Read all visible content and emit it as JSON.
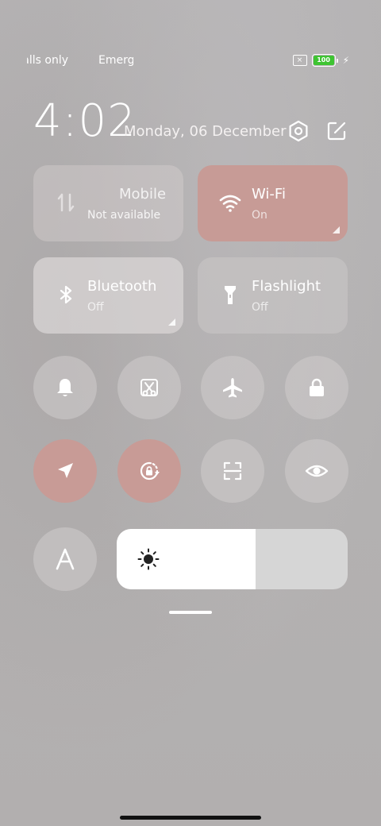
{
  "status_bar": {
    "carrier_left": "Emergency calls only",
    "carrier_right": "Emergency calls",
    "battery_level": "100",
    "colors": {
      "battery": "#3ec432"
    }
  },
  "header": {
    "time": "4:02",
    "date": "Monday, 06 December",
    "icons": [
      "settings-icon",
      "edit-icon"
    ]
  },
  "tiles": {
    "mobile": {
      "title": "Mobile data",
      "subtitle": "Not available",
      "icon": "mobile-data-icon"
    },
    "wifi": {
      "title": "Wi-Fi",
      "subtitle": "On",
      "icon": "wifi-icon"
    },
    "bluetooth": {
      "title": "Bluetooth",
      "subtitle": "Off",
      "icon": "bluetooth-icon"
    },
    "flashlight": {
      "title": "Flashlight",
      "subtitle": "Off",
      "icon": "flashlight-icon"
    }
  },
  "toggles": [
    {
      "name": "bell-icon",
      "active": false
    },
    {
      "name": "screenshot-icon",
      "active": false
    },
    {
      "name": "airplane-icon",
      "active": false
    },
    {
      "name": "lock-icon",
      "active": false
    },
    {
      "name": "location-icon",
      "active": true
    },
    {
      "name": "rotation-lock-icon",
      "active": true
    },
    {
      "name": "scanner-icon",
      "active": false
    },
    {
      "name": "eye-icon",
      "active": false
    },
    {
      "name": "font-icon",
      "active": false
    }
  ],
  "brightness": {
    "level": 0.6,
    "icon": "brightness-icon"
  },
  "colors": {
    "accent": "#c89b96",
    "background": "#b3b1b1"
  }
}
